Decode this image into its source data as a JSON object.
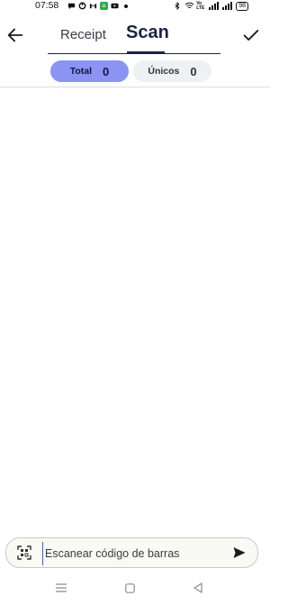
{
  "status_bar": {
    "time": "07:58",
    "battery": "98",
    "left_icons": [
      "chat-bubble-icon",
      "power-ring-icon",
      "gmail-icon",
      "green-app-icon",
      "youtube-icon",
      "dot-icon"
    ],
    "right_icons": [
      "bluetooth-icon",
      "wifi-icon",
      "volte-icon",
      "signal-1-icon",
      "signal-2-icon",
      "battery-icon"
    ],
    "volte_label": "Vo LTE"
  },
  "header": {
    "tabs": [
      {
        "label": "Receipt",
        "selected": false
      },
      {
        "label": "Scan",
        "selected": true
      }
    ],
    "accent_color": "#1c2340"
  },
  "counters": {
    "total": {
      "label": "Total",
      "value": "0",
      "color": "#8b93f3"
    },
    "unicos": {
      "label": "Únicos",
      "value": "0",
      "color": "#eef0f4"
    }
  },
  "scan_input": {
    "placeholder": "Escanear código de barras",
    "value": ""
  }
}
